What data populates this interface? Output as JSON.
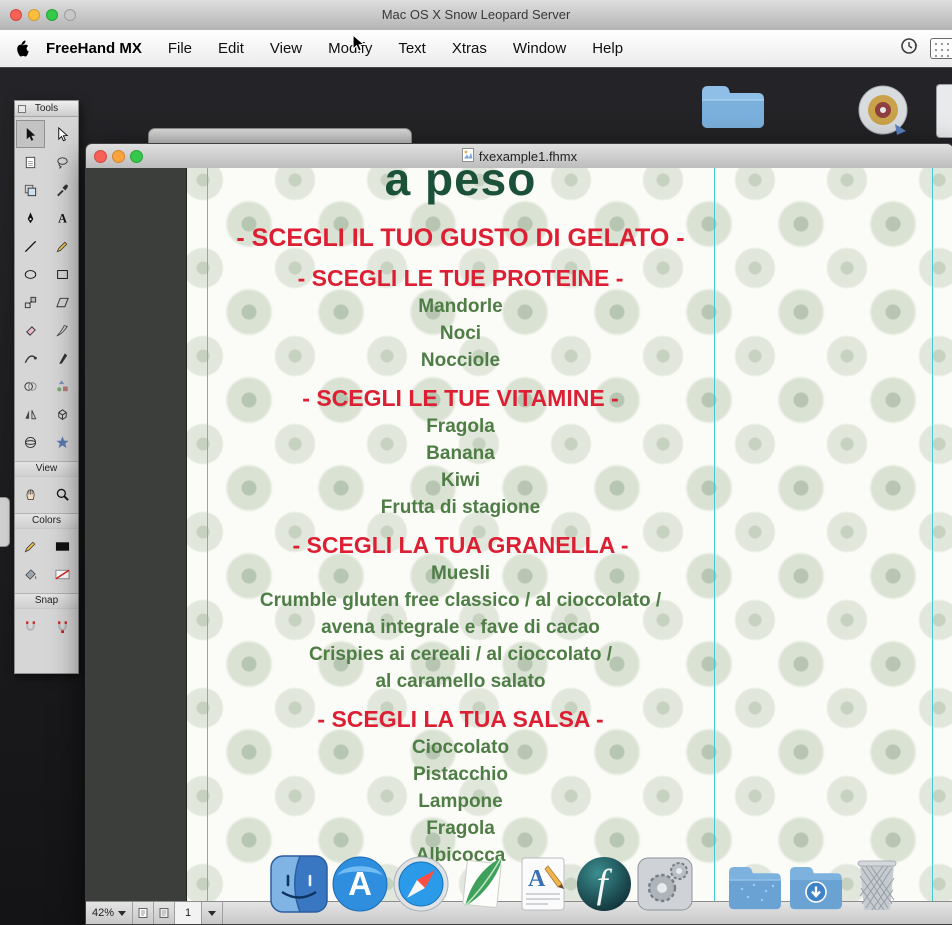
{
  "system": {
    "window_title": "Mac OS X Snow Leopard Server",
    "menubar": {
      "app_name": "FreeHand MX",
      "items": [
        "File",
        "Edit",
        "View",
        "Modify",
        "Text",
        "Xtras",
        "Window",
        "Help"
      ]
    }
  },
  "tools_panel": {
    "title": "Tools",
    "sections": {
      "view": "View",
      "colors": "Colors",
      "snap": "Snap"
    },
    "tool_icons": [
      "pointer",
      "subselect",
      "page",
      "lasso",
      "crop",
      "eyedropper",
      "pen",
      "text",
      "line",
      "pencil",
      "ellipse",
      "rectangle",
      "scale",
      "skew",
      "eraser",
      "knife",
      "freeform",
      "calligraphy",
      "blend",
      "hose",
      "mirror",
      "extrude",
      "rotate-3d",
      "action"
    ],
    "view_icons": [
      "hand",
      "zoom"
    ],
    "colors_icons": [
      "stroke-pencil",
      "stroke-swatch",
      "fill-bucket",
      "none-swatch"
    ],
    "snap_icons": [
      "snap-to-point",
      "snap-to-object"
    ]
  },
  "document_window": {
    "title": "fxexample1.fhmx",
    "statusbar": {
      "zoom": "42%",
      "page": "1"
    }
  },
  "gelato_menu": {
    "heading": "a peso",
    "colors": {
      "red": "#DD1F33",
      "green": "#4E7D45",
      "dark_green": "#1A5138"
    },
    "lines": [
      {
        "text": "- SCEGLI IL TUO GUSTO DI GELATO -",
        "style": "red-lg"
      },
      {
        "text": "- SCEGLI LE TUE PROTEINE -",
        "style": "red"
      },
      {
        "text": "Mandorle",
        "style": "green"
      },
      {
        "text": "Noci",
        "style": "green"
      },
      {
        "text": "Nocciole",
        "style": "green"
      },
      {
        "text": "- SCEGLI LE TUE VITAMINE -",
        "style": "red"
      },
      {
        "text": "Fragola",
        "style": "green"
      },
      {
        "text": "Banana",
        "style": "green"
      },
      {
        "text": "Kiwi",
        "style": "green"
      },
      {
        "text": "Frutta di stagione",
        "style": "green"
      },
      {
        "text": "- SCEGLI LA TUA GRANELLA -",
        "style": "red"
      },
      {
        "text": "Muesli",
        "style": "green"
      },
      {
        "text": "Crumble gluten free classico / al cioccolato /",
        "style": "green"
      },
      {
        "text": "avena integrale e fave di cacao",
        "style": "green"
      },
      {
        "text": "Crispies ai cereali / al cioccolato /",
        "style": "green"
      },
      {
        "text": "al caramello salato",
        "style": "green"
      },
      {
        "text": "- SCEGLI LA TUA SALSA -",
        "style": "red"
      },
      {
        "text": "Cioccolato",
        "style": "green"
      },
      {
        "text": "Pistacchio",
        "style": "green"
      },
      {
        "text": "Lampone",
        "style": "green"
      },
      {
        "text": "Fragola",
        "style": "green"
      },
      {
        "text": "Albicocca",
        "style": "green"
      }
    ]
  },
  "dock": {
    "icons": [
      "finder",
      "app-store",
      "safari",
      "feather",
      "text-editor",
      "flash",
      "system-preferences",
      "folder",
      "downloads-folder",
      "trash"
    ]
  },
  "desktop": {
    "icons": [
      "folder",
      "disc"
    ]
  }
}
